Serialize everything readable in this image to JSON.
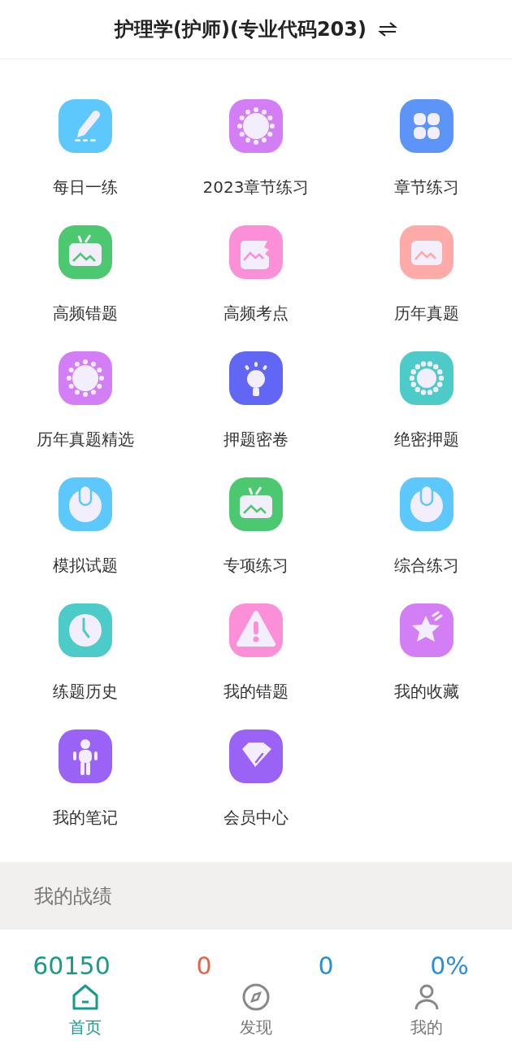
{
  "header": {
    "title": "护理学(护师)(专业代码203)"
  },
  "menu": [
    {
      "label": "每日一练",
      "kind": "pen",
      "color": "#5cc8fb"
    },
    {
      "label": "2023章节练习",
      "kind": "virus",
      "color": "#d47ef5"
    },
    {
      "label": "章节练习",
      "kind": "grid",
      "color": "#5c94f7"
    },
    {
      "label": "高频错题",
      "kind": "tv",
      "color": "#4cc870"
    },
    {
      "label": "高频考点",
      "kind": "photo-bite",
      "color": "#fb8fd8"
    },
    {
      "label": "历年真题",
      "kind": "photo",
      "color": "#fdaaa8"
    },
    {
      "label": "历年真题精选",
      "kind": "virus",
      "color": "#d47ef5"
    },
    {
      "label": "押题密卷",
      "kind": "bulb",
      "color": "#6266f5"
    },
    {
      "label": "绝密押题",
      "kind": "ring",
      "color": "#4ccbc8"
    },
    {
      "label": "模拟试题",
      "kind": "power",
      "color": "#5cc8fb"
    },
    {
      "label": "专项练习",
      "kind": "tv",
      "color": "#4cc870"
    },
    {
      "label": "综合练习",
      "kind": "power",
      "color": "#5cc8fb"
    },
    {
      "label": "练题历史",
      "kind": "clock",
      "color": "#4ccbc8"
    },
    {
      "label": "我的错题",
      "kind": "warning",
      "color": "#fb8fd8"
    },
    {
      "label": "我的收藏",
      "kind": "star",
      "color": "#d47ef5"
    },
    {
      "label": "我的笔记",
      "kind": "figure",
      "color": "#9a62f5"
    },
    {
      "label": "会员中心",
      "kind": "diamond",
      "color": "#9a62f5"
    }
  ],
  "record": {
    "title": "我的战绩",
    "stats": [
      {
        "value": "60150",
        "color": "#1a9a88"
      },
      {
        "value": "0",
        "color": "#e0654a"
      },
      {
        "value": "0",
        "color": "#2a8fd8"
      },
      {
        "value": "0%",
        "color": "#2a8fd8"
      }
    ]
  },
  "nav": [
    {
      "label": "首页",
      "kind": "home",
      "selected": true
    },
    {
      "label": "发现",
      "kind": "compass",
      "selected": false
    },
    {
      "label": "我的",
      "kind": "person",
      "selected": false
    }
  ]
}
